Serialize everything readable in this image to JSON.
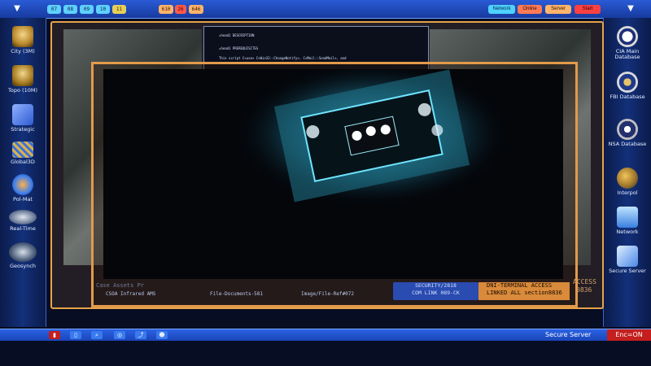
{
  "top_bar": {
    "left_codes": [
      "07",
      "08",
      "09",
      "10",
      "11"
    ],
    "mid_codes": [
      "610",
      "26",
      "646"
    ],
    "status": [
      "Network",
      "Online",
      "Server",
      "Start"
    ],
    "colors": {
      "bar": "#1d47b8",
      "code_blue": "#5fd0ff",
      "code_yellow": "#e6cf5a",
      "status_red": "#ff5a4a"
    }
  },
  "left_sidebar": {
    "items": [
      {
        "label": "City (3M)",
        "icon": "map-pin-icon"
      },
      {
        "label": "Topo (10M)",
        "icon": "map-pin-icon"
      },
      {
        "label": "Strategic",
        "icon": "folder-icon"
      },
      {
        "label": "Global3D",
        "icon": "globe-grid-icon"
      },
      {
        "label": "Pol-Mat",
        "icon": "world-map-icon"
      },
      {
        "label": "Real-Time",
        "icon": "world-map-icon"
      },
      {
        "label": "Geosynch",
        "icon": "world-map-icon"
      }
    ]
  },
  "right_sidebar": {
    "items": [
      {
        "label": "CIA Main Database",
        "icon": "cia-seal-icon"
      },
      {
        "label": "FBI Database",
        "icon": "fbi-seal-icon"
      },
      {
        "label": "NSA Database",
        "icon": "nsa-seal-icon"
      },
      {
        "label": "Interpol",
        "icon": "globe-icon"
      },
      {
        "label": "Network",
        "icon": "network-icon"
      },
      {
        "label": "Secure Server",
        "icon": "server-icon"
      }
    ]
  },
  "doc_window": {
    "lines": [
      "=head1 DESCRIPTION",
      "=head1 PREREQUISITES",
      "This script C<use> C<Win32::ChangeNotify>, C<Mail::SendMail>, and"
    ]
  },
  "tabs": {
    "items": [
      "CSOA Infrared AMS",
      "File-Documents-581",
      "Image/File-Ref#072"
    ],
    "ghost_left": "Case Assets Pr",
    "ghost_right": "ACCESS",
    "ghost_right2": "0836"
  },
  "security_box": {
    "line1": "SECURITY/2818",
    "line2": "COM LINK 089-CK"
  },
  "dni_box": {
    "line1": "DNI-TERMINAL ACCESS",
    "line2": "LINKED ALL section8836"
  },
  "bottom_bar": {
    "icons": [
      "lock-icon",
      "lock-open-icon",
      "search-icon",
      "globe-icon",
      "share-icon",
      "user-icon"
    ],
    "secure_label": "Secure Server",
    "enc_label": "Enc=ON"
  }
}
